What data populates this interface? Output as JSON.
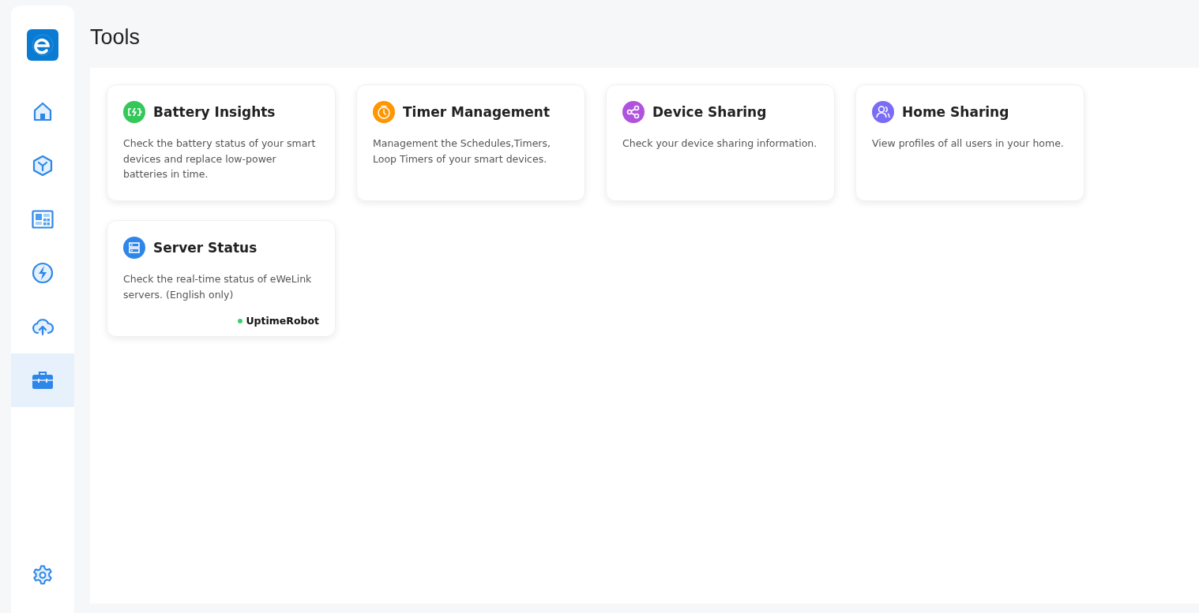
{
  "page": {
    "title": "Tools"
  },
  "sidebar": {
    "items": [
      {
        "kind": "home",
        "selected": false
      },
      {
        "kind": "cube",
        "selected": false
      },
      {
        "kind": "dashboard",
        "selected": false
      },
      {
        "kind": "bolt",
        "selected": false
      },
      {
        "kind": "cloud",
        "selected": false
      },
      {
        "kind": "toolbox",
        "selected": true
      }
    ],
    "footer_item": {
      "kind": "settings"
    }
  },
  "tools": [
    {
      "kind": "battery",
      "color": "#34c759",
      "title": "Battery Insights",
      "description": "Check the battery status of your smart devices and replace low-power batteries in time."
    },
    {
      "kind": "timer",
      "color": "#ff9500",
      "title": "Timer Management",
      "description": "Management the Schedules,Timers, Loop Timers of your smart devices."
    },
    {
      "kind": "share",
      "color": "#af52de",
      "title": "Device Sharing",
      "description": "Check your device sharing information."
    },
    {
      "kind": "users",
      "color": "#7b6cf6",
      "title": "Home Sharing",
      "description": "View profiles of all users in your home."
    },
    {
      "kind": "server",
      "color": "#2e86e8",
      "title": "Server Status",
      "description": "Check the real-time status of eWeLink servers. (English only)",
      "badge": {
        "label": "UptimeRobot",
        "color": "#3ccf6e"
      }
    }
  ]
}
